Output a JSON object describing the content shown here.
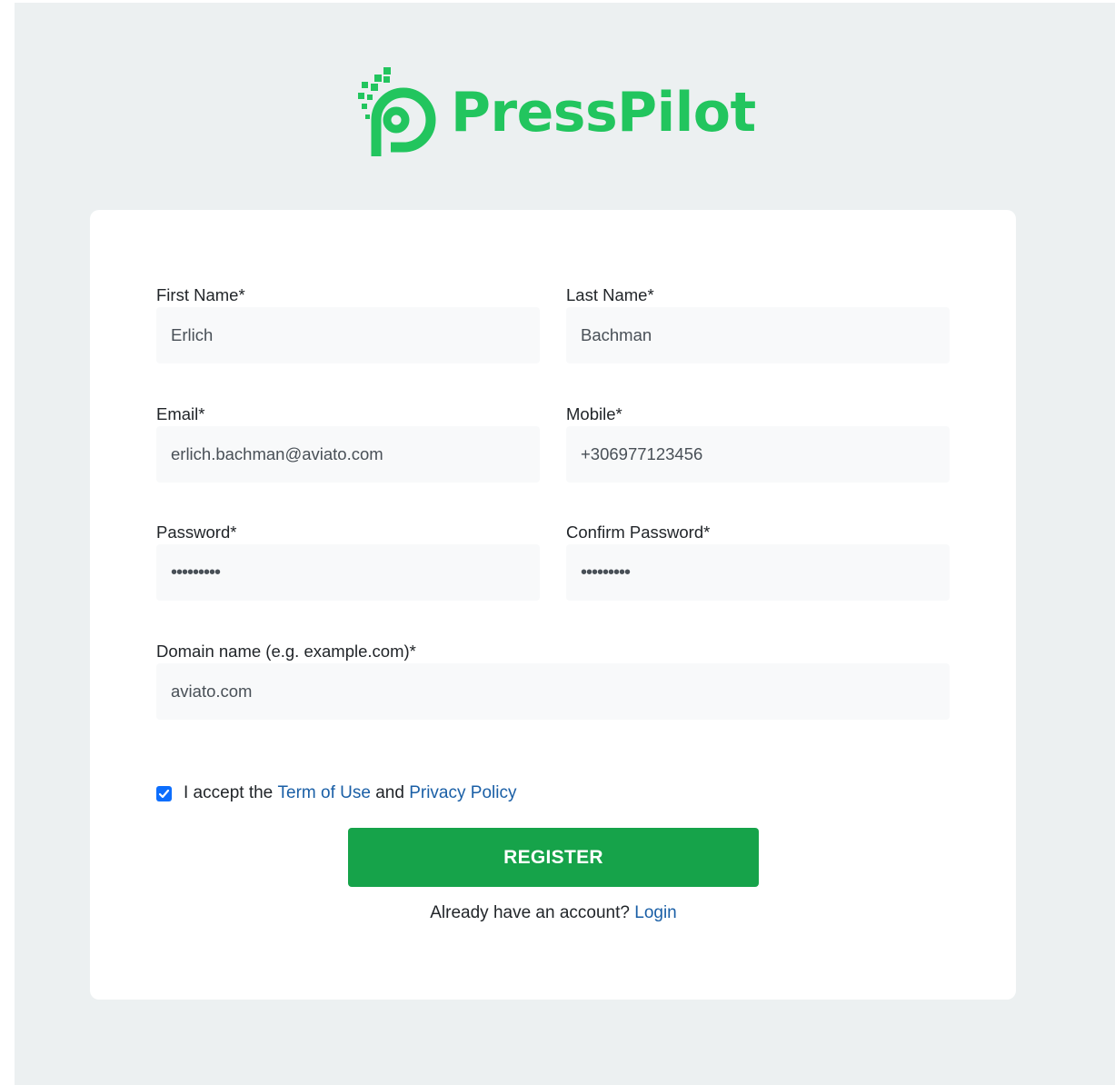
{
  "brand": {
    "name": "PressPilot",
    "color": "#22c55e",
    "icon": "presspilot-logo-icon"
  },
  "form": {
    "first_name": {
      "label": "First Name*",
      "value": "Erlich"
    },
    "last_name": {
      "label": "Last Name*",
      "value": "Bachman"
    },
    "email": {
      "label": "Email*",
      "value": "erlich.bachman@aviato.com"
    },
    "mobile": {
      "label": "Mobile*",
      "value": "+306977123456"
    },
    "password": {
      "label": "Password*",
      "value": "•••••••••"
    },
    "confirm_password": {
      "label": "Confirm Password*",
      "value": "•••••••••"
    },
    "domain": {
      "label": "Domain name (e.g. example.com)*",
      "value": "aviato.com"
    }
  },
  "terms": {
    "checked": true,
    "prefix": "I accept the",
    "terms_link": "Term of Use",
    "conjunction": "and",
    "privacy_link": "Privacy Policy"
  },
  "register_button": {
    "label": "REGISTER",
    "color": "#16a34a"
  },
  "login": {
    "prompt": "Already have an account?",
    "link": "Login"
  }
}
